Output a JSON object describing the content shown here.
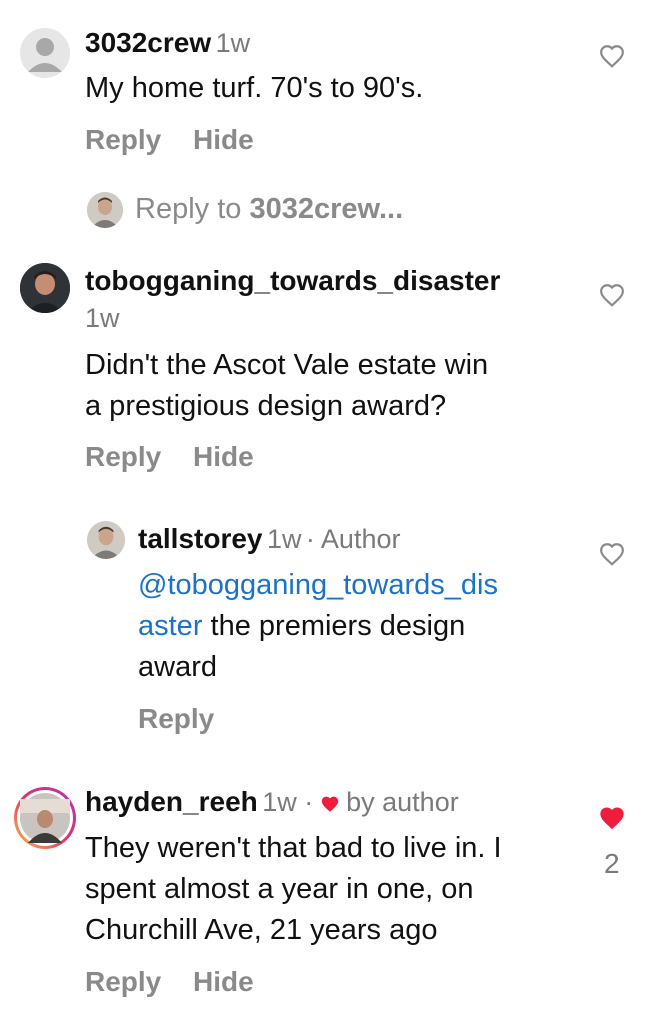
{
  "comments": [
    {
      "username": "3032crew",
      "time": "1w",
      "text": "My home turf. 70's to 90's.",
      "reply_label": "Reply",
      "hide_label": "Hide"
    },
    {
      "reply_prefix": "Reply to ",
      "reply_target": "3032crew..."
    },
    {
      "username": "tobogganing_towards_disaster",
      "time": "1w",
      "text_line1": "Didn't the Ascot Vale estate win",
      "text_line2": "a prestigious design award?",
      "reply_label": "Reply",
      "hide_label": "Hide"
    },
    {
      "username": "tallstorey",
      "time": "1w",
      "author_badge": "· Author",
      "mention_line1": "@tobogganing_towards_dis",
      "mention_line2": "aster",
      "text_rest": " the premiers design",
      "text_line3": "award",
      "reply_label": "Reply"
    },
    {
      "username": "hayden_reeh",
      "time": "1w ·",
      "liked_by": "by author",
      "text_line1": "They weren't that bad to live in. I",
      "text_line2": "spent almost a year in one, on",
      "text_line3": "Churchill Ave, 21 years ago",
      "like_count": "2",
      "reply_label": "Reply",
      "hide_label": "Hide"
    }
  ],
  "colors": {
    "mention": "#1a73c9",
    "heart_liked": "#ef1c3c",
    "muted": "#8a8a8a"
  },
  "icons": [
    "heart-outline-icon",
    "heart-filled-icon",
    "default-avatar-icon"
  ]
}
